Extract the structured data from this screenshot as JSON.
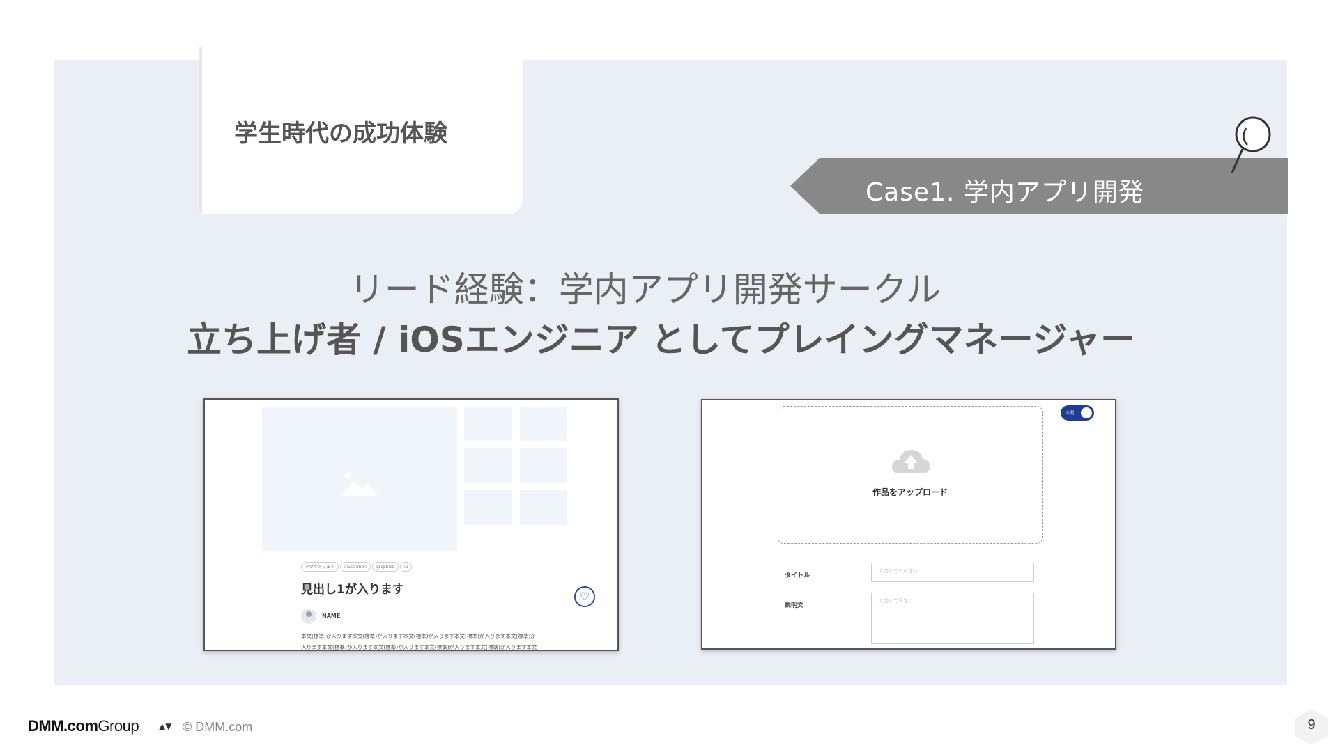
{
  "section": {
    "title": "学生時代の成功体験"
  },
  "case": {
    "label": "Case1. 学内アプリ開発"
  },
  "headline": {
    "lead": "リード経験：学内アプリ開発サークル",
    "role": "立ち上げ者 / iOSエンジニア としてプレイングマネージャー"
  },
  "screenshot_left": {
    "tags": [
      "タグが入ります",
      "illustration",
      "graphics",
      "ui"
    ],
    "heading": "見出し1が入ります",
    "author_name": "NAME",
    "body_lines": [
      "本文(標準)が入ります本文(標準)が入ります本文(標準)が入ります本文(標準)が入ります本文(標準)が",
      "入ります本文(標準)が入ります本文(標準)が入ります本文(標準)が入ります本文(標準)が入ります本文"
    ],
    "icons": [
      "image-placeholder-icon",
      "heart-icon"
    ]
  },
  "screenshot_right": {
    "upload_label": "作品をアップロード",
    "toggle_label": "公開",
    "fields": [
      {
        "label": "タイトル",
        "placeholder": "入力してください"
      },
      {
        "label": "説明文",
        "placeholder": "入力して下さい"
      }
    ],
    "icons": [
      "cloud-upload-icon"
    ]
  },
  "footer": {
    "logo_bold": "DMM",
    "logo_mid": ".com",
    "logo_light": "Group",
    "copyright": "© DMM.com",
    "page_number": "9"
  },
  "colors": {
    "panel": "#eaeef5",
    "ribbon": "#888888",
    "accent": "#1f3d94"
  }
}
